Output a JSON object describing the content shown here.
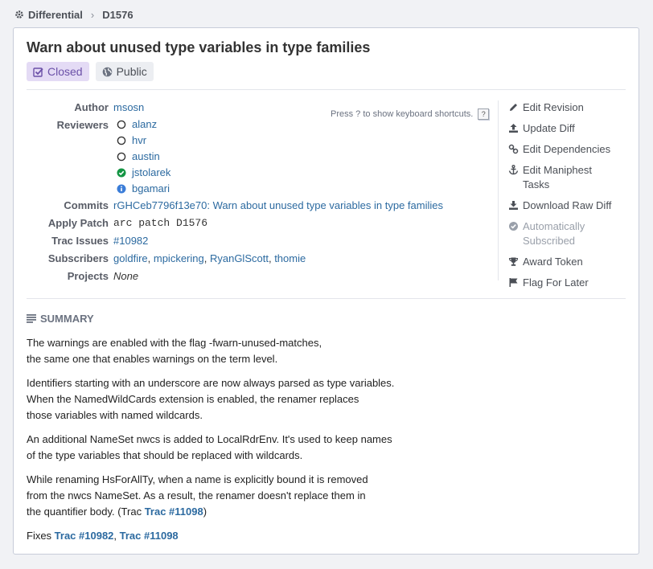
{
  "breadcrumb": {
    "app": "Differential",
    "item": "D1576"
  },
  "revision": {
    "title": "Warn about unused type variables in type families",
    "status": "Closed",
    "visibility": "Public"
  },
  "keyboard_hint": "Press ? to show keyboard shortcuts.",
  "keyboard_key": "?",
  "properties": {
    "author_label": "Author",
    "author": "msosn",
    "reviewers_label": "Reviewers",
    "reviewers": [
      {
        "name": "alanz",
        "state": "pending"
      },
      {
        "name": "hvr",
        "state": "pending"
      },
      {
        "name": "austin",
        "state": "pending"
      },
      {
        "name": "jstolarek",
        "state": "accepted"
      },
      {
        "name": "bgamari",
        "state": "info"
      }
    ],
    "commits_label": "Commits",
    "commits": "rGHCeb7796f13e70: Warn about unused type variables in type families",
    "apply_patch_label": "Apply Patch",
    "apply_patch": "arc patch D1576",
    "trac_label": "Trac Issues",
    "trac": "#10982",
    "subscribers_label": "Subscribers",
    "subscribers": [
      "goldfire",
      "mpickering",
      "RyanGlScott",
      "thomie"
    ],
    "projects_label": "Projects",
    "projects": "None"
  },
  "actions": [
    {
      "label": "Edit Revision",
      "icon": "pencil-icon"
    },
    {
      "label": "Update Diff",
      "icon": "upload-icon"
    },
    {
      "label": "Edit Dependencies",
      "icon": "link-icon"
    },
    {
      "label": "Edit Maniphest Tasks",
      "icon": "anchor-icon"
    },
    {
      "label": "Download Raw Diff",
      "icon": "download-icon"
    },
    {
      "label": "Automatically Subscribed",
      "icon": "check-circle-icon"
    },
    {
      "label": "Award Token",
      "icon": "trophy-icon"
    },
    {
      "label": "Flag For Later",
      "icon": "flag-icon"
    }
  ],
  "summary": {
    "heading": "SUMMARY",
    "p1": [
      "The warnings are enabled with the flag -fwarn-unused-matches,",
      "the same one that enables warnings on the term level."
    ],
    "p2": [
      "Identifiers starting with an underscore are now always parsed as type variables.",
      "When the NamedWildCards extension is enabled, the renamer replaces",
      "those variables with named wildcards."
    ],
    "p3": [
      "An additional NameSet nwcs is added to LocalRdrEnv. It's used to keep names",
      "of the type variables that should be replaced with wildcards."
    ],
    "p4": [
      "While renaming HsForAllTy, when a name is explicitly bound it is removed",
      "from the nwcs NameSet. As a result, the renamer doesn't replace them in"
    ],
    "p4_last_prefix": "the quantifier body. (Trac ",
    "p4_link": "Trac #11098",
    "p4_last_suffix": ")",
    "fixes_prefix": "Fixes ",
    "fixes_link1": "Trac #10982",
    "fixes_sep": ", ",
    "fixes_link2": "Trac #11098"
  },
  "colors": {
    "link": "#2c6aa0",
    "accepted": "#139543",
    "info": "#3b7dd8",
    "closed_bg": "#e4dbf5"
  }
}
